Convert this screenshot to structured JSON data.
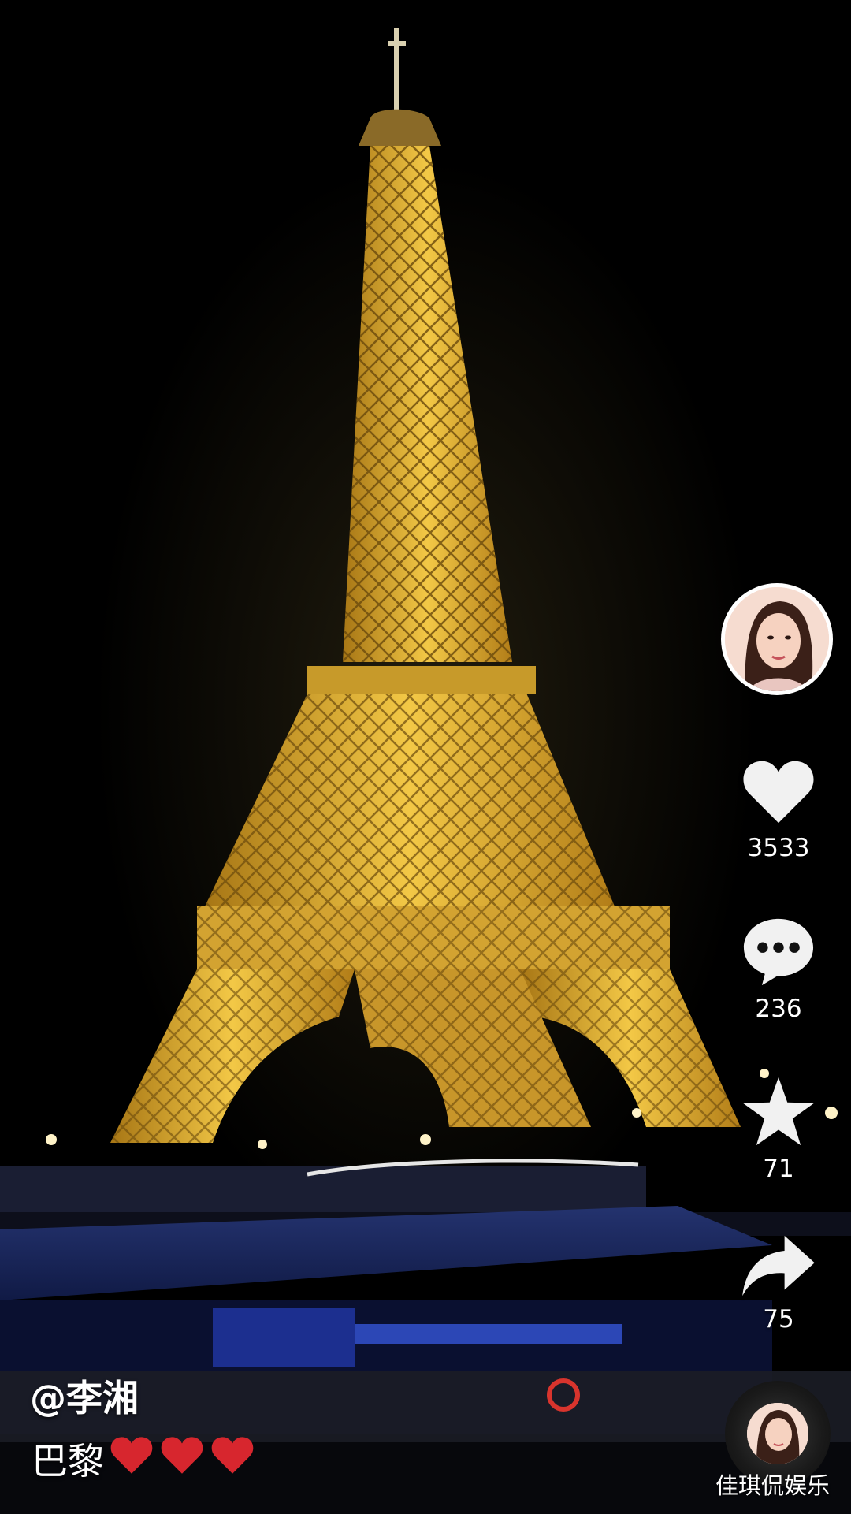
{
  "video": {
    "author_handle": "@李湘",
    "caption_text": "巴黎",
    "caption_emojis": [
      "heart-emoji",
      "heart-emoji",
      "heart-emoji"
    ]
  },
  "actions": {
    "likes": "3533",
    "comments": "236",
    "favorites": "71",
    "shares": "75"
  },
  "watermark": "佳琪侃娱乐",
  "icons": {
    "like": "heart-icon",
    "comment": "comment-bubble-icon",
    "favorite": "star-icon",
    "share": "share-arrow-icon"
  },
  "colors": {
    "tower_gold": "#e8b32a",
    "sky": "#000000",
    "boat_blue": "#1c2a6e",
    "emoji_red": "#d7262e"
  }
}
